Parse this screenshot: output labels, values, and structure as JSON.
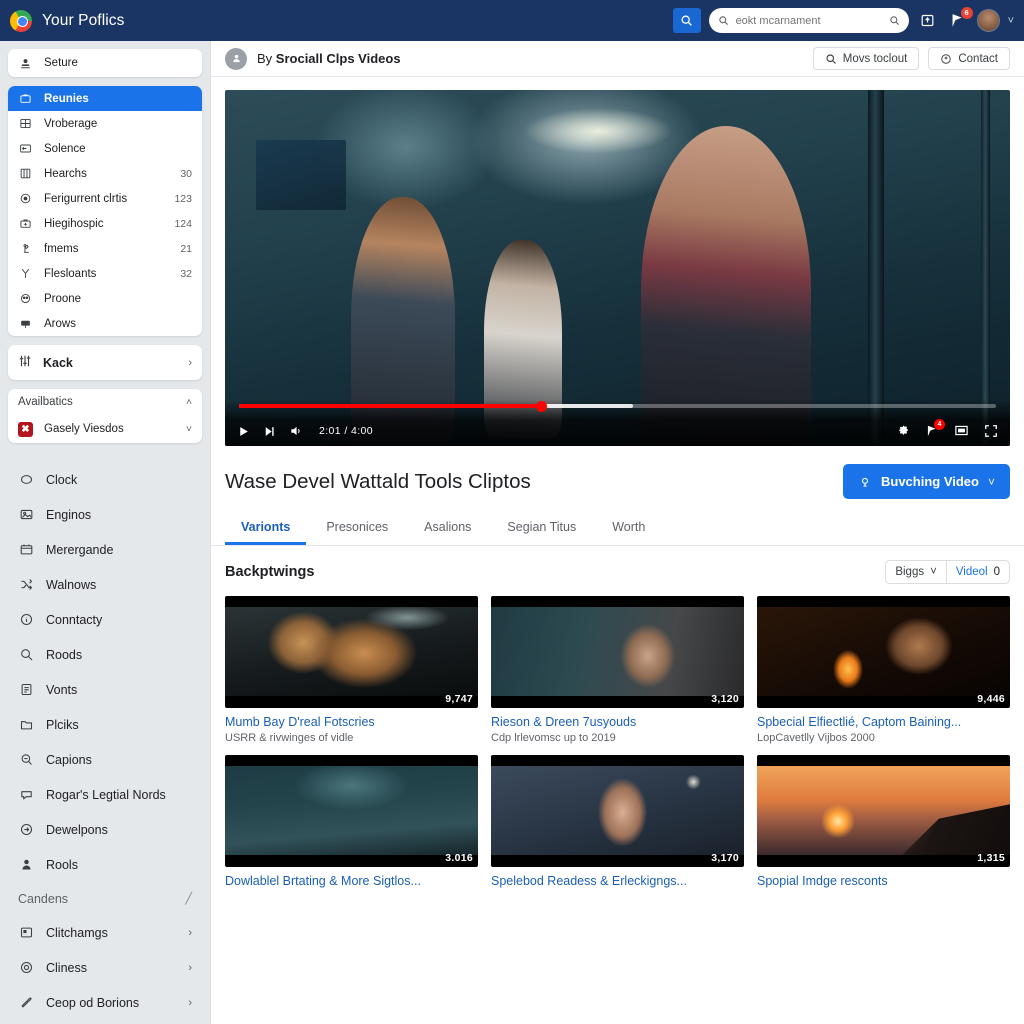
{
  "topbar": {
    "brand_title": "Your Poflics",
    "logo_icon": "chrome-logo-icon",
    "search_button_icon": "search-icon",
    "search_placeholder": "eokt mcarnament",
    "search_value": "",
    "search_inner_icon": "search-icon",
    "home_icon": "home-icon",
    "notifications_icon": "bookmark-flag-icon",
    "notifications_badge": "6",
    "avatar": "user-avatar",
    "chevron": "˅"
  },
  "sidebar": {
    "account_row": {
      "label": "Seture",
      "icon": "person-pin-icon"
    },
    "nav_items": [
      {
        "label": "Reunies",
        "icon": "briefcase-icon",
        "count": "",
        "active": true
      },
      {
        "label": "Vroberage",
        "icon": "grid-icon",
        "count": "",
        "active": false
      },
      {
        "label": "Solence",
        "icon": "window-icon",
        "count": "",
        "active": false
      },
      {
        "label": "Hearchs",
        "icon": "columns-icon",
        "count": "30",
        "active": false
      },
      {
        "label": "Ferigurrent clrtis",
        "icon": "target-icon",
        "count": "123",
        "active": false
      },
      {
        "label": "Hiegihospic",
        "icon": "medkit-icon",
        "count": "124",
        "active": false
      },
      {
        "label": "fmems",
        "icon": "microscope-icon",
        "count": "21",
        "active": false
      },
      {
        "label": "Flesloants",
        "icon": "branch-icon",
        "count": "32",
        "active": false
      },
      {
        "label": "Proone",
        "icon": "owl-icon",
        "count": "",
        "active": false
      },
      {
        "label": "Arows",
        "icon": "mailbox-icon",
        "count": "",
        "active": false
      }
    ],
    "kack": {
      "label": "Kack",
      "icon": "sliders-icon",
      "chevron": "›"
    },
    "availabilities": {
      "label": "Availbatics",
      "chevron": "˄",
      "channel": {
        "label": "Gasely Viesdos",
        "icon": "youtube-tile-icon",
        "glyph": "✖",
        "chevron": "˅"
      }
    },
    "plain_items": [
      {
        "label": "Clock",
        "icon": "clock-icon",
        "chevron": ""
      },
      {
        "label": "Enginos",
        "icon": "image-icon",
        "chevron": ""
      },
      {
        "label": "Merergande",
        "icon": "calendar-icon",
        "chevron": ""
      },
      {
        "label": "Walnows",
        "icon": "shuffle-icon",
        "chevron": ""
      },
      {
        "label": "Conntacty",
        "icon": "info-icon",
        "chevron": ""
      },
      {
        "label": "Roods",
        "icon": "search-icon",
        "chevron": ""
      },
      {
        "label": "Vonts",
        "icon": "list-icon",
        "chevron": ""
      },
      {
        "label": "Plciks",
        "icon": "folder-icon",
        "chevron": ""
      },
      {
        "label": "Capions",
        "icon": "zoom-icon",
        "chevron": ""
      },
      {
        "label": "Rogar's Legtial Nords",
        "icon": "chat-icon",
        "chevron": ""
      },
      {
        "label": "Dewelpons",
        "icon": "arrow-circle-icon",
        "chevron": ""
      },
      {
        "label": "Rools",
        "icon": "user-icon",
        "chevron": ""
      }
    ],
    "group": {
      "label": "Candens",
      "chevron": "╱"
    },
    "group_items": [
      {
        "label": "Clitchamgs",
        "icon": "device-icon",
        "chevron": "›"
      },
      {
        "label": "Cliness",
        "icon": "gauge-icon",
        "chevron": "›"
      },
      {
        "label": "Ceop od Borions",
        "icon": "wrench-icon",
        "chevron": "›"
      }
    ]
  },
  "channel_bar": {
    "avatar_icon": "channel-avatar-icon",
    "by_text": "By",
    "channel_name": "Srociall Clps Videos",
    "search_button": {
      "label": "Movs toclout",
      "icon": "search-icon"
    },
    "contact_button": {
      "label": "Contact",
      "icon": "contact-badge-icon"
    }
  },
  "player": {
    "time": "2:01 / 4:00",
    "progress_percent": 40,
    "buffered_percent": 52,
    "play_icon": "play-icon",
    "next_icon": "next-track-icon",
    "volume_icon": "volume-icon",
    "settings_icon": "gear-icon",
    "alert_icon": "alert-icon",
    "alert_badge": "4",
    "theater_icon": "theater-mode-icon",
    "fullscreen_icon": "fullscreen-icon"
  },
  "video": {
    "title": "Wase Devel Wattald Tools Cliptos",
    "subscribe": {
      "label": "Buvching Video",
      "icon": "bell-icon",
      "chevron": "˅"
    }
  },
  "tabs": [
    {
      "label": "Varionts",
      "active": true
    },
    {
      "label": "Presonices",
      "active": false
    },
    {
      "label": "Asalions",
      "active": false
    },
    {
      "label": "Segian Titus",
      "active": false
    },
    {
      "label": "Worth",
      "active": false
    }
  ],
  "section": {
    "title": "Backptwings",
    "sort": {
      "label": "Biggs",
      "chevron": "˅"
    },
    "view": {
      "label": "Videol",
      "count": "0"
    }
  },
  "videos": [
    {
      "title": "Mumb Bay D'real Fotscries",
      "meta": "USRR & rivwinges of vidle",
      "duration": "9,747",
      "scene": "sc-dogs"
    },
    {
      "title": "Rieson & Dreen 7usyouds",
      "meta": "Cdp lrlevomsc up to 2019",
      "duration": "3,120",
      "scene": "sc-street"
    },
    {
      "title": "Spbecial Elfiectlié, Captom Baining...",
      "meta": "LopCavetlly Vijbos 2000",
      "duration": "9,446",
      "scene": "sc-fire"
    },
    {
      "title": "Dowlablel Brtating & More Sigtlos...",
      "meta": "",
      "duration": "3.016",
      "scene": "sc-fight"
    },
    {
      "title": "Spelebod Readess & Erleckigngs...",
      "meta": "",
      "duration": "3,170",
      "scene": "sc-crowd"
    },
    {
      "title": "Spopial Imdge resconts",
      "meta": "",
      "duration": "1,315",
      "scene": "sc-sunset"
    }
  ]
}
